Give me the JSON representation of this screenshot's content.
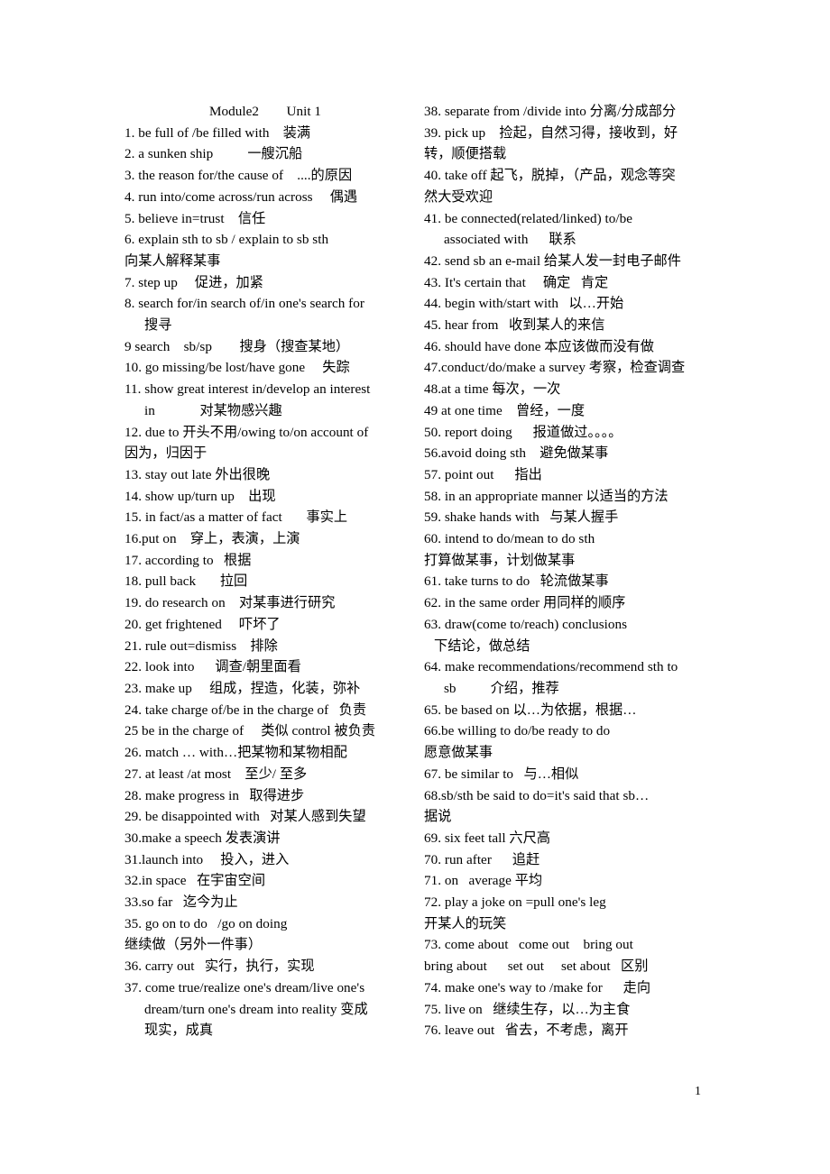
{
  "document": {
    "title_line": "Module2        Unit 1",
    "page_number": "1",
    "left_column": [
      {
        "text": "Module2        Unit 1",
        "style": "center"
      },
      {
        "text": "1. be full of /be filled with    装满",
        "style": "normal"
      },
      {
        "text": "2. a sunken ship          一艘沉船",
        "style": "normal"
      },
      {
        "text": "3. the reason for/the cause of    ....的原因",
        "style": "normal"
      },
      {
        "text": "4. run into/come across/run across     偶遇",
        "style": "normal"
      },
      {
        "text": "5. believe in=trust    信任",
        "style": "normal"
      },
      {
        "text": "6. explain sth to sb / explain to sb sth",
        "style": "normal"
      },
      {
        "text": "向某人解释某事",
        "style": "normal"
      },
      {
        "text": "7. step up     促进，加紧",
        "style": "normal"
      },
      {
        "text": "8. search for/in search of/in one's search for",
        "style": "normal"
      },
      {
        "text": "搜寻",
        "style": "indent"
      },
      {
        "text": "9 search    sb/sp        搜身（搜查某地）",
        "style": "normal"
      },
      {
        "text": "10. go missing/be lost/have gone     失踪",
        "style": "normal"
      },
      {
        "text": "11. show great interest in/develop an interest",
        "style": "normal"
      },
      {
        "text": "in             对某物感兴趣",
        "style": "indent"
      },
      {
        "text": "12. due to 开头不用/owing to/on account of",
        "style": "normal"
      },
      {
        "text": "因为，归因于",
        "style": "normal"
      },
      {
        "text": "13. stay out late 外出很晚",
        "style": "normal"
      },
      {
        "text": "14. show up/turn up    出现",
        "style": "normal"
      },
      {
        "text": "15. in fact/as a matter of fact       事实上",
        "style": "normal"
      },
      {
        "text": "16.put on    穿上，表演，上演",
        "style": "normal"
      },
      {
        "text": "17. according to   根据",
        "style": "normal"
      },
      {
        "text": "18. pull back       拉回",
        "style": "normal"
      },
      {
        "text": "19. do research on    对某事进行研究",
        "style": "normal"
      },
      {
        "text": "20. get frightened     吓坏了",
        "style": "normal"
      },
      {
        "text": "21. rule out=dismiss    排除",
        "style": "normal"
      },
      {
        "text": "22. look into      调查/朝里面看",
        "style": "normal"
      },
      {
        "text": "23. make up     组成，捏造，化装，弥补",
        "style": "normal"
      },
      {
        "text": "24. take charge of/be in the charge of   负责",
        "style": "normal"
      },
      {
        "text": "25 be in the charge of     类似 control 被负责",
        "style": "normal"
      },
      {
        "text": "26. match … with…把某物和某物相配",
        "style": "normal"
      },
      {
        "text": "27. at least /at most    至少/ 至多",
        "style": "normal"
      },
      {
        "text": "28. make progress in   取得进步",
        "style": "normal"
      },
      {
        "text": "29. be disappointed with   对某人感到失望",
        "style": "normal"
      },
      {
        "text": "30.make a speech 发表演讲",
        "style": "normal"
      },
      {
        "text": "31.launch into     投入，进入",
        "style": "normal"
      },
      {
        "text": "32.in space   在宇宙空间",
        "style": "normal"
      },
      {
        "text": "33.so far   迄今为止",
        "style": "normal"
      },
      {
        "text": "35. go on to do   /go on doing",
        "style": "normal"
      },
      {
        "text": "继续做（另外一件事）",
        "style": "normal"
      },
      {
        "text": "36. carry out   实行，执行，实现",
        "style": "normal"
      },
      {
        "text": "37. come true/realize one's dream/live one's",
        "style": "normal"
      },
      {
        "text": "dream/turn one's dream into reality 变成",
        "style": "indent"
      },
      {
        "text": "现实，成真",
        "style": "indent"
      }
    ],
    "right_column": [
      {
        "text": "38. separate from /divide into 分离/分成部分",
        "style": "normal"
      },
      {
        "text": "39. pick up    捡起，自然习得，接收到，好",
        "style": "normal"
      },
      {
        "text": "转，顺便搭载",
        "style": "normal"
      },
      {
        "text": "40. take off 起飞，脱掉，（产品，观念等突",
        "style": "normal"
      },
      {
        "text": "然大受欢迎",
        "style": "normal"
      },
      {
        "text": "41. be connected(related/linked) to/be",
        "style": "normal"
      },
      {
        "text": "associated with      联系",
        "style": "indent"
      },
      {
        "text": "42. send sb an e-mail 给某人发一封电子邮件",
        "style": "normal"
      },
      {
        "text": "43. It's certain that     确定   肯定",
        "style": "normal"
      },
      {
        "text": "44. begin with/start with   以…开始",
        "style": "normal"
      },
      {
        "text": "45. hear from   收到某人的来信",
        "style": "normal"
      },
      {
        "text": "46. should have done 本应该做而没有做",
        "style": "normal"
      },
      {
        "text": "47.conduct/do/make a survey 考察，检查调查",
        "style": "normal"
      },
      {
        "text": "48.at a time 每次，一次",
        "style": "normal"
      },
      {
        "text": "49 at one time    曾经，一度",
        "style": "normal"
      },
      {
        "text": "50. report doing      报道做过。。。。",
        "style": "normal"
      },
      {
        "text": "56.avoid doing sth    避免做某事",
        "style": "normal"
      },
      {
        "text": "57. point out      指出",
        "style": "normal"
      },
      {
        "text": "58. in an appropriate manner 以适当的方法",
        "style": "normal"
      },
      {
        "text": "59. shake hands with   与某人握手",
        "style": "normal"
      },
      {
        "text": "60. intend to do/mean to do sth",
        "style": "normal"
      },
      {
        "text": "打算做某事，计划做某事",
        "style": "normal"
      },
      {
        "text": "61. take turns to do   轮流做某事",
        "style": "normal"
      },
      {
        "text": "62. in the same order 用同样的顺序",
        "style": "normal"
      },
      {
        "text": "63. draw(come to/reach) conclusions",
        "style": "normal"
      },
      {
        "text": "下结论，做总结",
        "style": "indent2"
      },
      {
        "text": "64. make recommendations/recommend sth to",
        "style": "normal"
      },
      {
        "text": "sb          介绍，推荐",
        "style": "indent"
      },
      {
        "text": "65. be based on 以…为依据，根据…",
        "style": "normal"
      },
      {
        "text": "66.be willing to do/be ready to do",
        "style": "normal"
      },
      {
        "text": "愿意做某事",
        "style": "normal"
      },
      {
        "text": "67. be similar to   与…相似",
        "style": "normal"
      },
      {
        "text": "68.sb/sth be said to do=it's said that sb…",
        "style": "normal"
      },
      {
        "text": "据说",
        "style": "normal"
      },
      {
        "text": "69. six feet tall 六尺高",
        "style": "normal"
      },
      {
        "text": "70. run after      追赶",
        "style": "normal"
      },
      {
        "text": "71. on   average 平均",
        "style": "normal"
      },
      {
        "text": "72. play a joke on =pull one's leg",
        "style": "normal"
      },
      {
        "text": "开某人的玩笑",
        "style": "normal"
      },
      {
        "text": "73. come about   come out    bring out",
        "style": "normal"
      },
      {
        "text": "bring about      set out     set about   区别",
        "style": "normal"
      },
      {
        "text": "74. make one's way to /make for      走向",
        "style": "normal"
      },
      {
        "text": "75. live on   继续生存，以…为主食",
        "style": "normal"
      },
      {
        "text": "76. leave out   省去，不考虑，离开",
        "style": "normal"
      }
    ]
  }
}
